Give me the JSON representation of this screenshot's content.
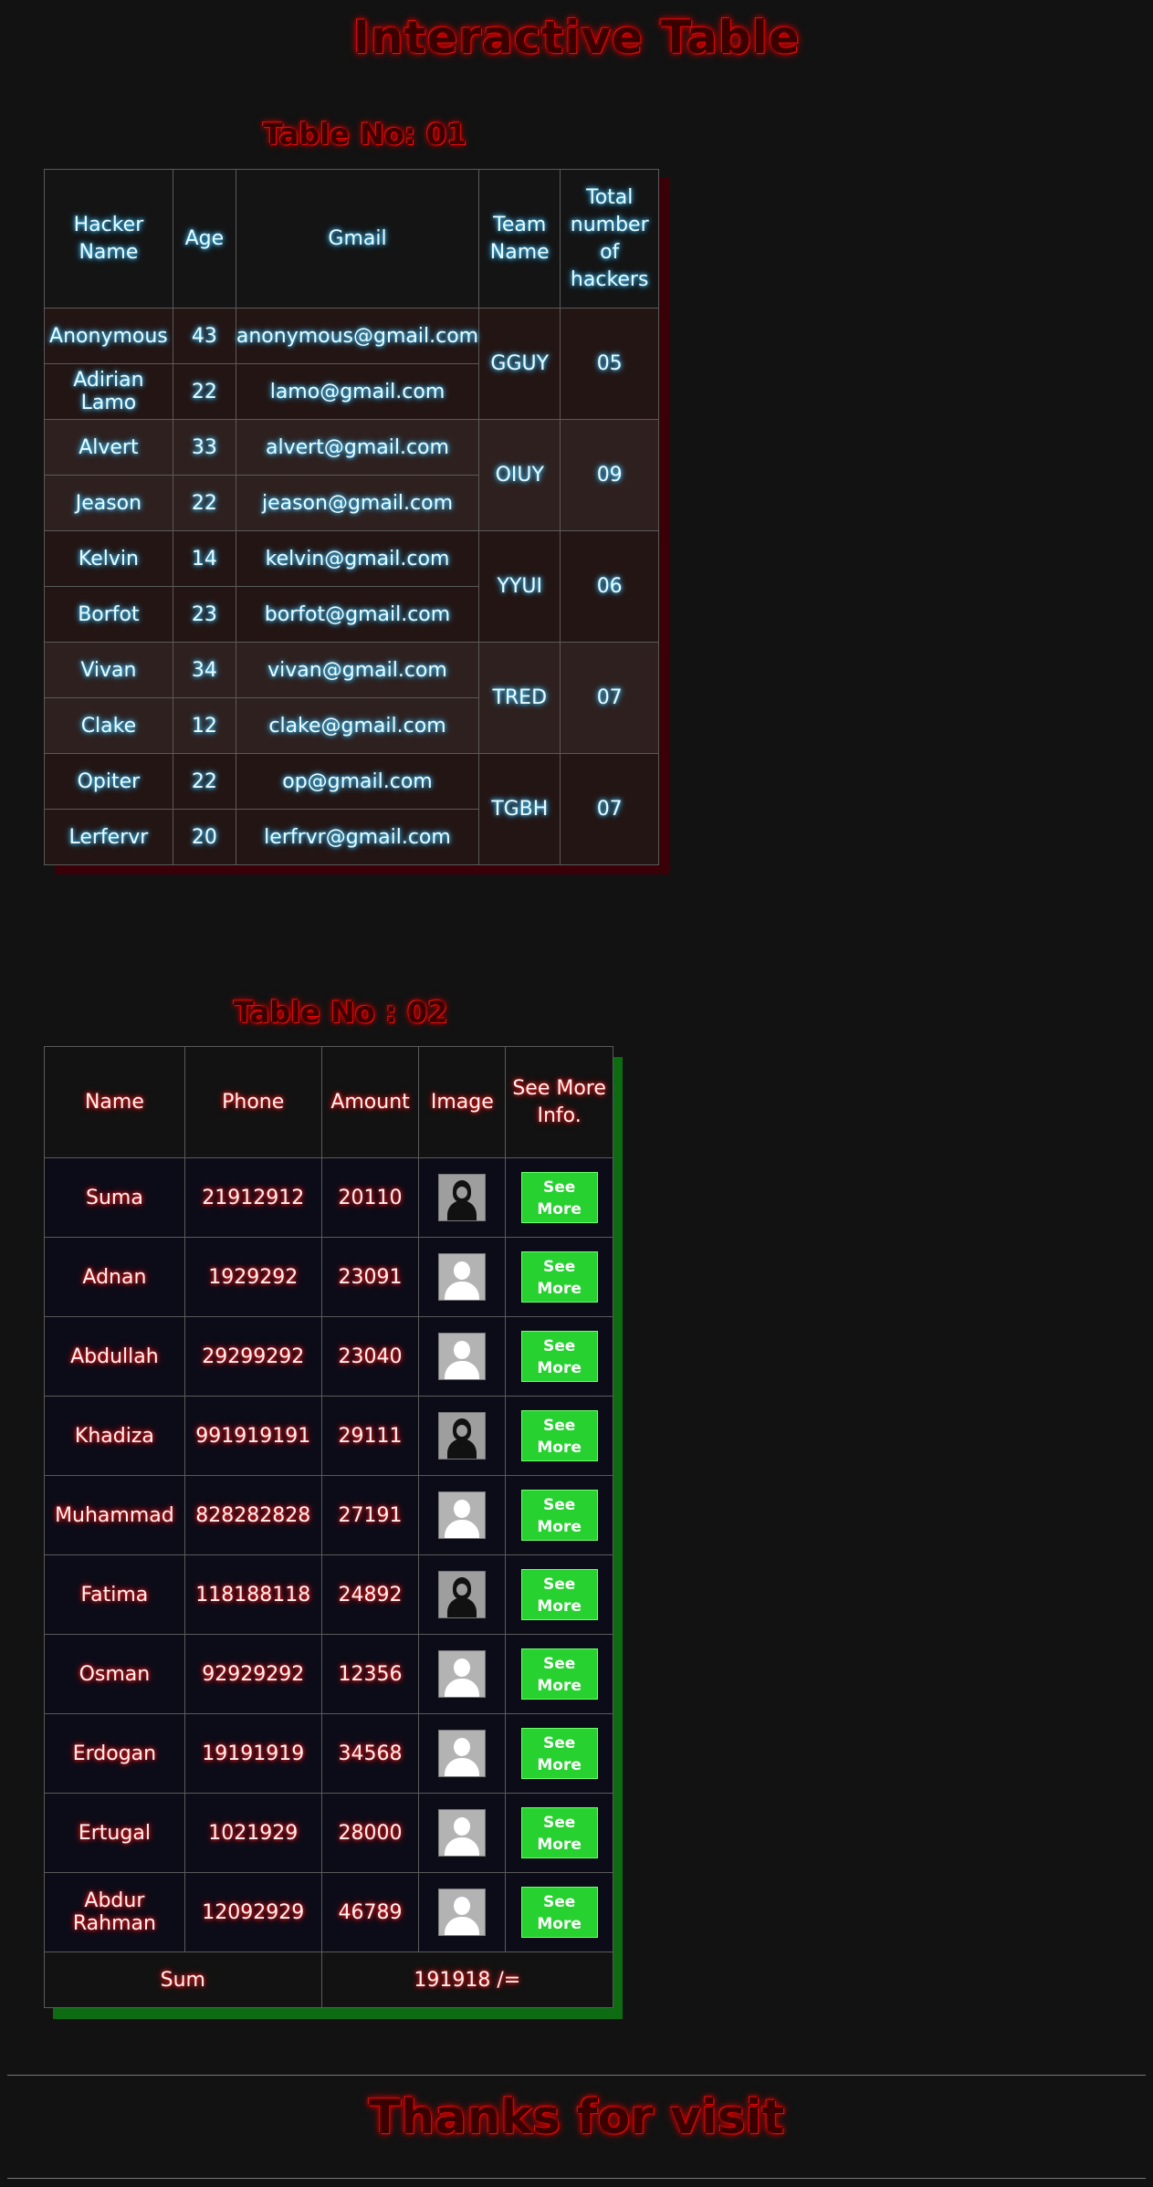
{
  "title": "Interactive Table",
  "table1": {
    "caption": "Table No: 01",
    "headers": [
      "Hacker Name",
      "Age",
      "Gmail",
      "Team Name",
      "Total number of hackers"
    ],
    "rows": [
      {
        "name": "Anonymous",
        "age": "43",
        "gmail": "anonymous@gmail.com"
      },
      {
        "name": "Adirian Lamo",
        "age": "22",
        "gmail": "lamo@gmail.com"
      },
      {
        "name": "Alvert",
        "age": "33",
        "gmail": "alvert@gmail.com"
      },
      {
        "name": "Jeason",
        "age": "22",
        "gmail": "jeason@gmail.com"
      },
      {
        "name": "Kelvin",
        "age": "14",
        "gmail": "kelvin@gmail.com"
      },
      {
        "name": "Borfot",
        "age": "23",
        "gmail": "borfot@gmail.com"
      },
      {
        "name": "Vivan",
        "age": "34",
        "gmail": "vivan@gmail.com"
      },
      {
        "name": "Clake",
        "age": "12",
        "gmail": "clake@gmail.com"
      },
      {
        "name": "Opiter",
        "age": "22",
        "gmail": "op@gmail.com"
      },
      {
        "name": "Lerfervr",
        "age": "20",
        "gmail": "lerfrvr@gmail.com"
      }
    ],
    "teams": [
      {
        "team": "GGUY",
        "total": "05"
      },
      {
        "team": "OIUY",
        "total": "09"
      },
      {
        "team": "YYUI",
        "total": "06"
      },
      {
        "team": "TRED",
        "total": "07"
      },
      {
        "team": "TGBH",
        "total": "07"
      }
    ]
  },
  "table2": {
    "caption": "Table No : 02",
    "headers": [
      "Name",
      "Phone",
      "Amount",
      "Image",
      "See More Info."
    ],
    "button_label": "See More",
    "rows": [
      {
        "name": "Suma",
        "phone": "21912912",
        "amount": "20110",
        "image": "female-avatar-icon"
      },
      {
        "name": "Adnan",
        "phone": "1929292",
        "amount": "23091",
        "image": "male-avatar-icon"
      },
      {
        "name": "Abdullah",
        "phone": "29299292",
        "amount": "23040",
        "image": "male-avatar-icon"
      },
      {
        "name": "Khadiza",
        "phone": "991919191",
        "amount": "29111",
        "image": "female-avatar-icon"
      },
      {
        "name": "Muhammad",
        "phone": "828282828",
        "amount": "27191",
        "image": "male-avatar-icon"
      },
      {
        "name": "Fatima",
        "phone": "118188118",
        "amount": "24892",
        "image": "female-avatar-icon"
      },
      {
        "name": "Osman",
        "phone": "92929292",
        "amount": "12356",
        "image": "male-avatar-icon"
      },
      {
        "name": "Erdogan",
        "phone": "19191919",
        "amount": "34568",
        "image": "male-avatar-icon"
      },
      {
        "name": "Ertugal",
        "phone": "1021929",
        "amount": "28000",
        "image": "male-avatar-icon"
      },
      {
        "name": "Abdur Rahman",
        "phone": "12092929",
        "amount": "46789",
        "image": "male-avatar-icon"
      }
    ],
    "sum_label": "Sum",
    "sum_value": "191918 /="
  },
  "footer": "Thanks for visit",
  "colors": {
    "background": "#121212",
    "title_glow": "#e10000",
    "table1_text_glow": "#4fd6ff",
    "table2_text_glow": "#ff2a2a",
    "button": "#27d130"
  }
}
